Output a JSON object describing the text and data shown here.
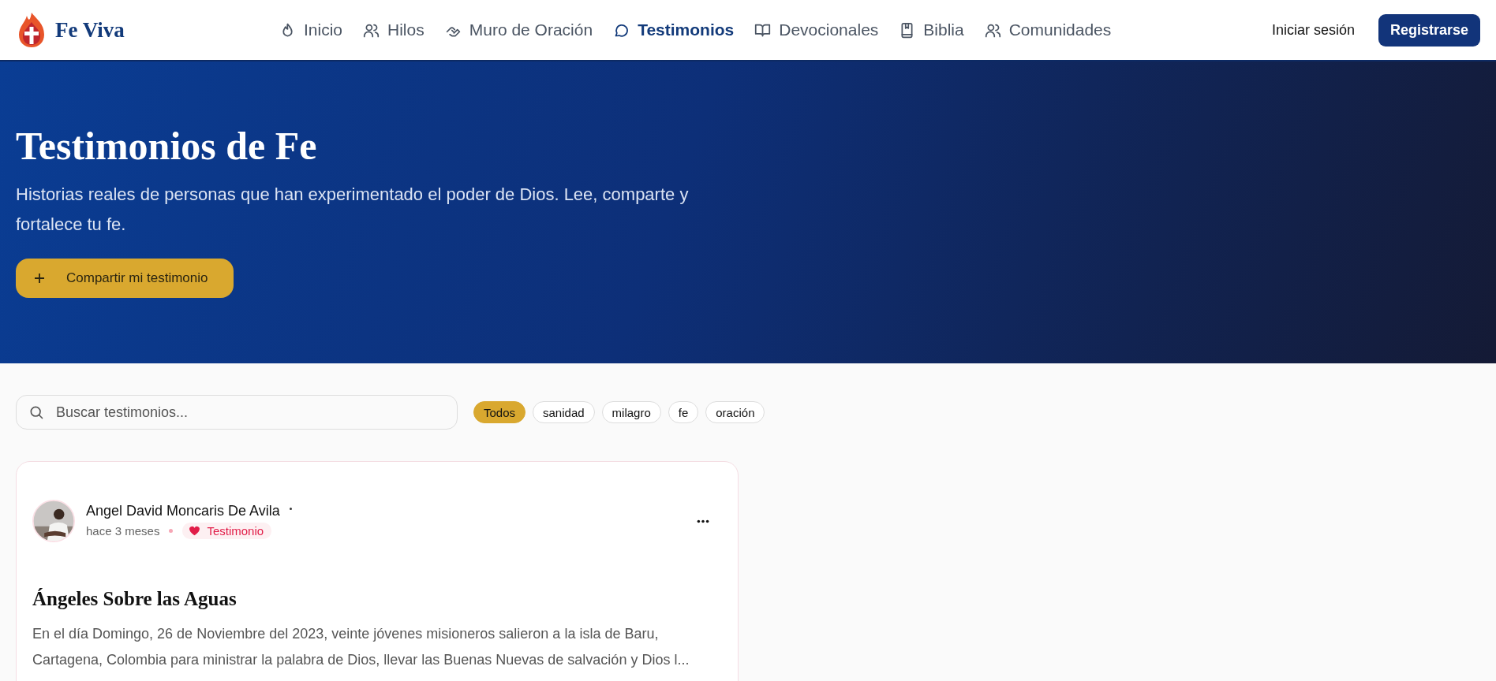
{
  "brand": {
    "name": "Fe Viva"
  },
  "nav": [
    {
      "label": "Inicio",
      "kind": "flame",
      "selected": false
    },
    {
      "label": "Hilos",
      "kind": "users",
      "selected": false
    },
    {
      "label": "Muro de Oración",
      "kind": "hands",
      "selected": false
    },
    {
      "label": "Testimonios",
      "kind": "chat",
      "selected": true
    },
    {
      "label": "Devocionales",
      "kind": "book",
      "selected": false
    },
    {
      "label": "Biblia",
      "kind": "bible",
      "selected": false
    },
    {
      "label": "Comunidades",
      "kind": "community",
      "selected": false
    }
  ],
  "auth": {
    "login": "Iniciar sesión",
    "register": "Registrarse"
  },
  "hero": {
    "title": "Testimonios de Fe",
    "subtitle": "Historias reales de personas que han experimentado el poder de Dios. Lee, comparte y fortalece tu fe.",
    "button": "Compartir mi testimonio"
  },
  "search": {
    "placeholder": "Buscar testimonios..."
  },
  "filters": [
    {
      "label": "Todos",
      "selected": true
    },
    {
      "label": "sanidad",
      "selected": false
    },
    {
      "label": "milagro",
      "selected": false
    },
    {
      "label": "fe",
      "selected": false
    },
    {
      "label": "oración",
      "selected": false
    }
  ],
  "posts": [
    {
      "author": "Angel David Moncaris De Avila",
      "time": "hace 3 meses",
      "tag": "Testimonio",
      "title": "Ángeles Sobre las Aguas",
      "excerpt": "En el día Domingo, 26 de Noviembre del 2023, veinte jóvenes misioneros salieron a la isla de Baru, Cartagena, Colombia para ministrar la palabra de Dios, llevar las Buenas Nuevas de salvación y Dios l..."
    }
  ]
}
